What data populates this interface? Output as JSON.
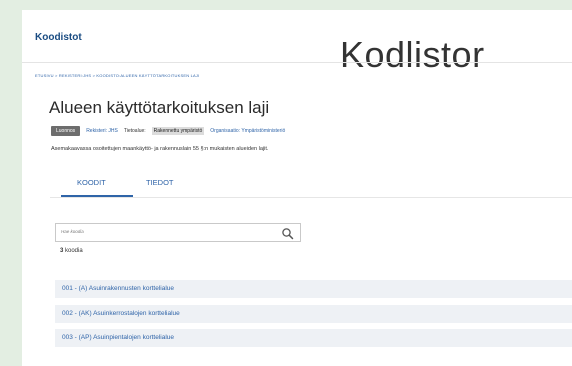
{
  "header": {
    "brand": "Koodistot",
    "overlay_title": "Kodlistor"
  },
  "breadcrumb": "ETUSIVU  >  REKISTERI:JHS  >  KOODISTO:ALUEEN KÄYTTÖTARKOITUKSEN LAJI",
  "page": {
    "title": "Alueen käyttötarkoituksen laji",
    "status": "Luonnos",
    "registry": "Rekisteri: JHS",
    "data_area_label": "Tietoalue:",
    "data_area_value": "Rakennettu ympäristö",
    "organization": "Organisaatio: Ympäristöministeriö",
    "description": "Asemakaavassa osoitettujen maankäyttö- ja rakennuslain 55 §:n mukaisten alueiden lajit."
  },
  "tabs": [
    {
      "label": "KOODIT",
      "active": true
    },
    {
      "label": "TIEDOT",
      "active": false
    }
  ],
  "search": {
    "placeholder": "Hae koodia",
    "icon": "search-icon"
  },
  "results": {
    "count": "3",
    "count_label": " koodia"
  },
  "codes": [
    {
      "label": "001 - (A) Asuinrakennusten korttelialue"
    },
    {
      "label": "002 - (AK) Asuinkerrostalojen korttelialue"
    },
    {
      "label": "003 - (AP) Asuinpientalojen korttelialue"
    }
  ],
  "colors": {
    "accent": "#2f64a8",
    "background": "#e3eee2",
    "row_background": "#eef1f5"
  }
}
